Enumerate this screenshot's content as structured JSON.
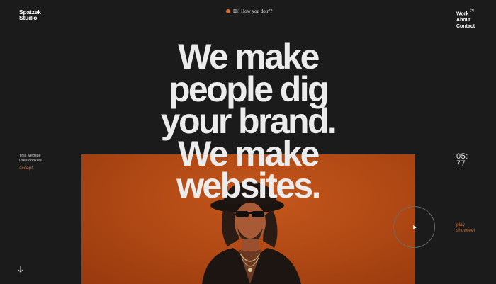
{
  "header": {
    "logo_line1": "Spatzek",
    "logo_line2": "Studio",
    "greeting": "Hi! How you doin'?",
    "nav": {
      "work": "Work",
      "work_count": "(7)",
      "about": "About",
      "contact": "Contact"
    }
  },
  "hero": {
    "headline_lines": [
      "We make",
      "people dig",
      "your brand.",
      "We make",
      "websites."
    ]
  },
  "cookie_notice": {
    "line1": "This website",
    "line2": "uses cookies.",
    "accept_label": "accept"
  },
  "clock": {
    "line1": "05:",
    "line2": "77"
  },
  "showreel": {
    "line1": "play",
    "line2": "showreel"
  },
  "colors": {
    "background": "#1b1b1b",
    "accent": "#d9702f",
    "hero_image": "#b24a15",
    "text": "#ececec"
  },
  "icons": {
    "scroll": "arrow-down-icon",
    "play": "play-icon",
    "greeting_dot": "status-dot-icon"
  }
}
